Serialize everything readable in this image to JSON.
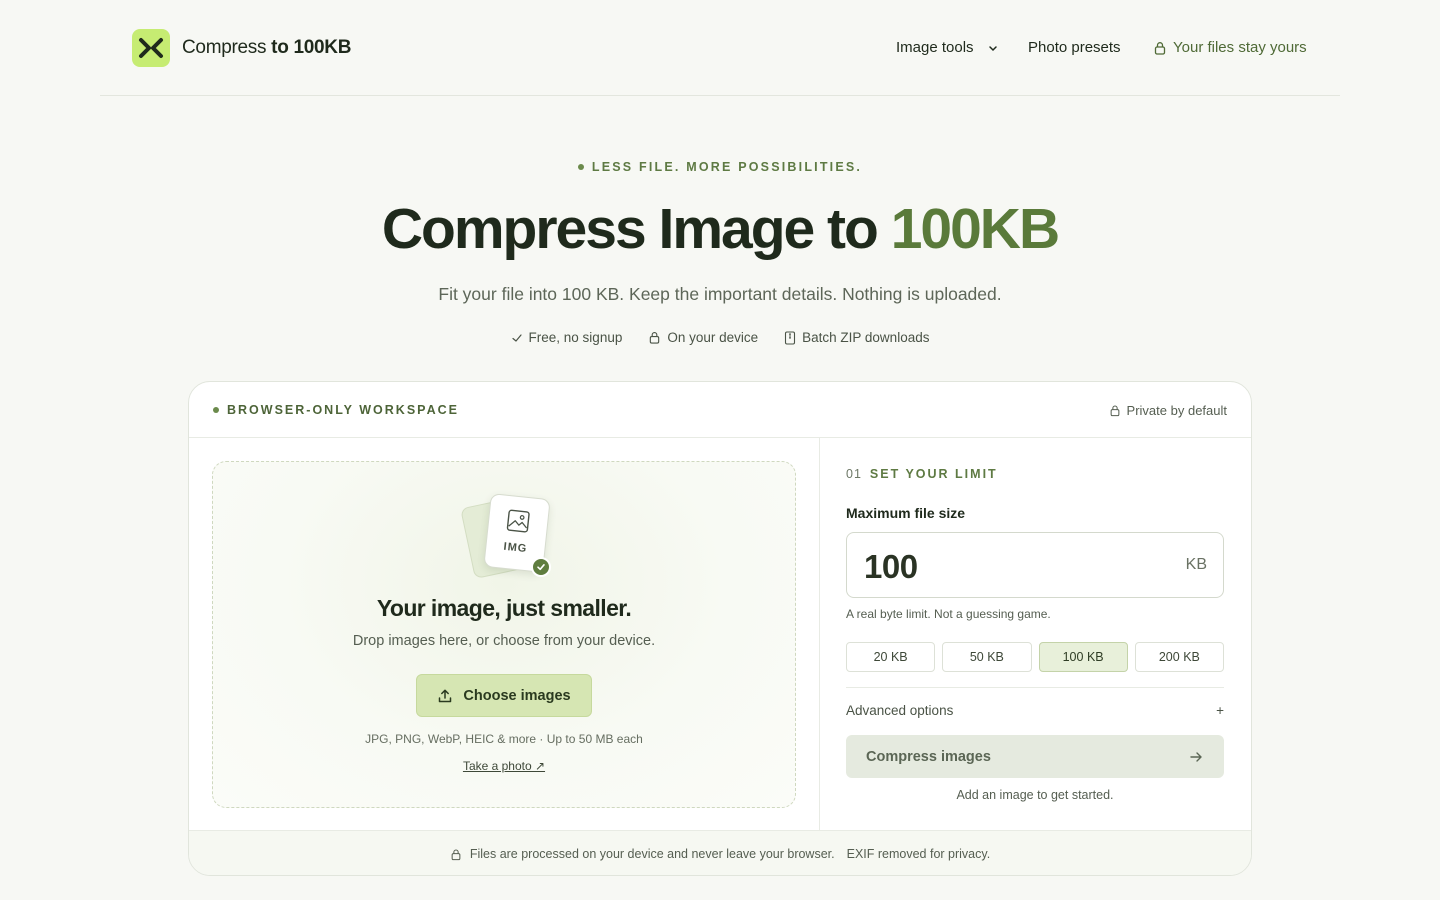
{
  "brand": {
    "name_regular": "Compress",
    "name_bold": "to 100KB",
    "accent_color": "#c6ec72"
  },
  "nav": {
    "image_tools": "Image tools",
    "photo_presets": "Photo presets",
    "privacy": "Your files stay yours"
  },
  "hero": {
    "eyebrow": "LESS FILE. MORE POSSIBILITIES.",
    "title_main": "Compress Image to ",
    "title_accent": "100KB",
    "subtitle": "Fit your file into 100 KB. Keep the important details. Nothing is uploaded.",
    "badges": [
      "Free, no signup",
      "On your device",
      "Batch ZIP downloads"
    ]
  },
  "workspace": {
    "label": "BROWSER-ONLY WORKSPACE",
    "private_label": "Private by default",
    "dropzone": {
      "icon_label": "IMG",
      "title": "Your image, just smaller.",
      "subtitle": "Drop images here, or choose from your device.",
      "choose_button": "Choose images",
      "formats": "JPG, PNG, WebP, HEIC & more · Up to 50 MB each",
      "take_photo": "Take a photo ↗"
    },
    "limit": {
      "step_number": "01",
      "step_label": "SET YOUR LIMIT",
      "field_label": "Maximum file size",
      "value": "100",
      "unit": "KB",
      "hint": "A real byte limit. Not a guessing game.",
      "presets": [
        "20 KB",
        "50 KB",
        "100 KB",
        "200 KB"
      ],
      "active_preset": "100 KB",
      "advanced": "Advanced options",
      "advanced_toggle": "+",
      "compress_button": "Compress images",
      "start_hint": "Add an image to get started."
    },
    "footer": {
      "privacy": "Files are processed on your device and never leave your browser.",
      "exif": "EXIF removed for privacy."
    }
  },
  "colors": {
    "accent_text": "#5a7a3a",
    "background": "#f7f8f4",
    "button_green": "#d6e6b3"
  }
}
